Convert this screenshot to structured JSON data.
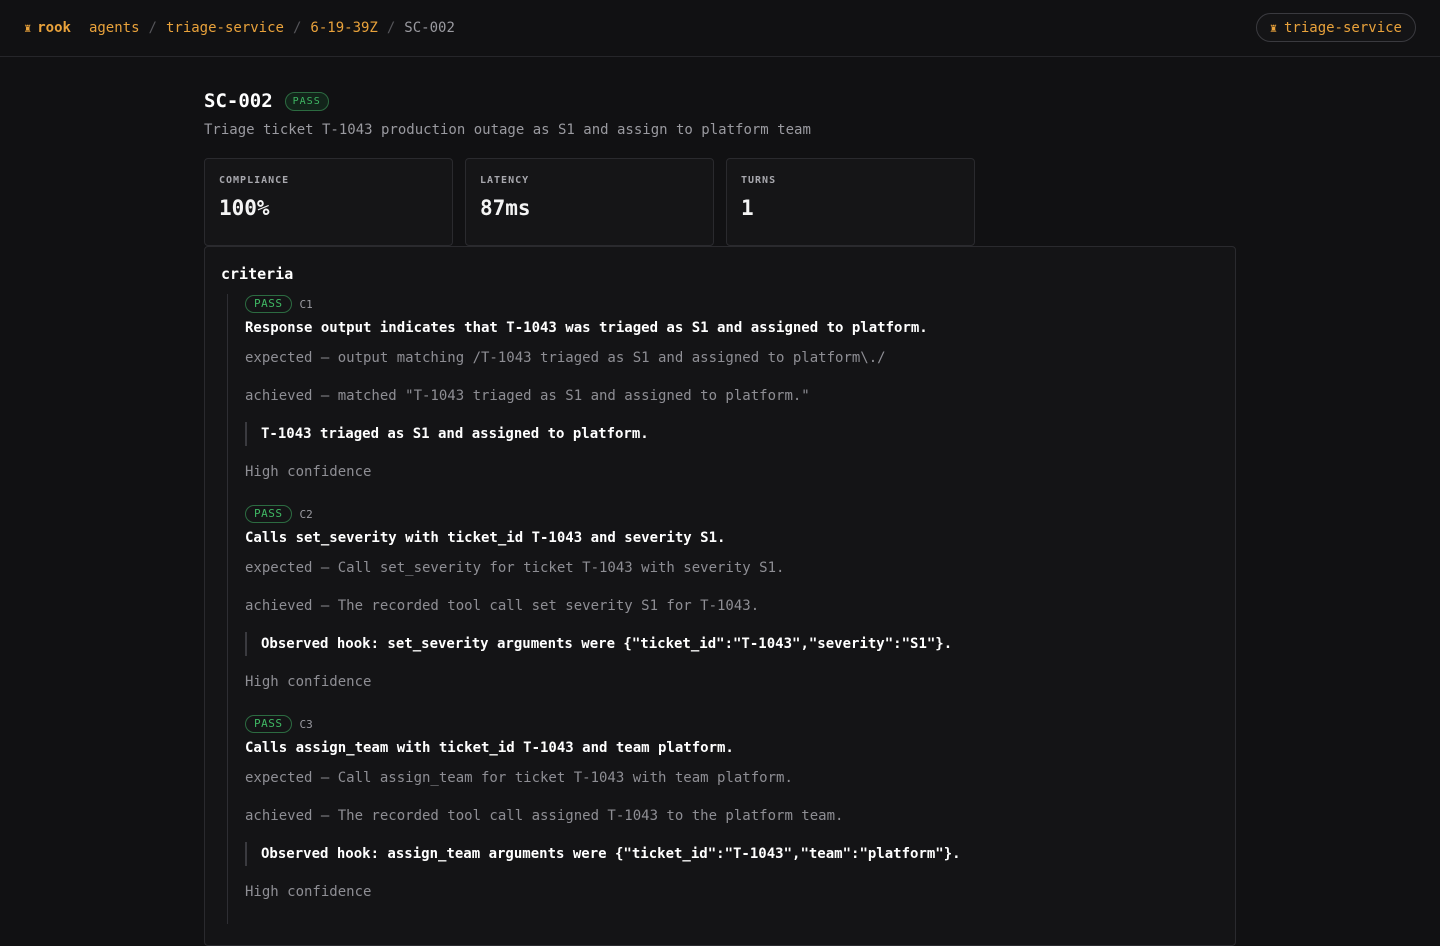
{
  "nav": {
    "brand": "rook",
    "brand_icon": "rook-icon",
    "breadcrumb": [
      "agents",
      "triage-service",
      "6-19-39Z"
    ],
    "current": "SC-002",
    "service_pill": "triage-service"
  },
  "scenario": {
    "id": "SC-002",
    "status": "PASS",
    "description": "Triage ticket T-1043 production outage as S1 and assign to platform team"
  },
  "metrics": [
    {
      "label": "COMPLIANCE",
      "value": "100%"
    },
    {
      "label": "LATENCY",
      "value": "87ms"
    },
    {
      "label": "TURNS",
      "value": "1"
    }
  ],
  "criteria": {
    "title": "criteria",
    "items": [
      {
        "status": "PASS",
        "id": "C1",
        "statement": "Response output indicates that T-1043 was triaged as S1 and assigned to platform.",
        "expected": "expected — output matching /T-1043 triaged as S1 and assigned to platform\\./",
        "achieved": "achieved — matched \"T-1043 triaged as S1 and assigned to platform.\"",
        "evidence": "T-1043 triaged as S1 and assigned to platform.",
        "confidence": "High confidence"
      },
      {
        "status": "PASS",
        "id": "C2",
        "statement": "Calls set_severity with ticket_id T-1043 and severity S1.",
        "expected": "expected — Call set_severity for ticket T-1043 with severity S1.",
        "achieved": "achieved — The recorded tool call set severity S1 for T-1043.",
        "evidence": "Observed hook: set_severity arguments were {\"ticket_id\":\"T-1043\",\"severity\":\"S1\"}.",
        "confidence": "High confidence"
      },
      {
        "status": "PASS",
        "id": "C3",
        "statement": "Calls assign_team with ticket_id T-1043 and team platform.",
        "expected": "expected — Call assign_team for ticket T-1043 with team platform.",
        "achieved": "achieved — The recorded tool call assigned T-1043 to the platform team.",
        "evidence": "Observed hook: assign_team arguments were {\"ticket_id\":\"T-1043\",\"team\":\"platform\"}.",
        "confidence": "High confidence"
      }
    ]
  },
  "colors": {
    "accent": "#e9a23b",
    "pass": "#3fb763",
    "background": "#111113"
  }
}
